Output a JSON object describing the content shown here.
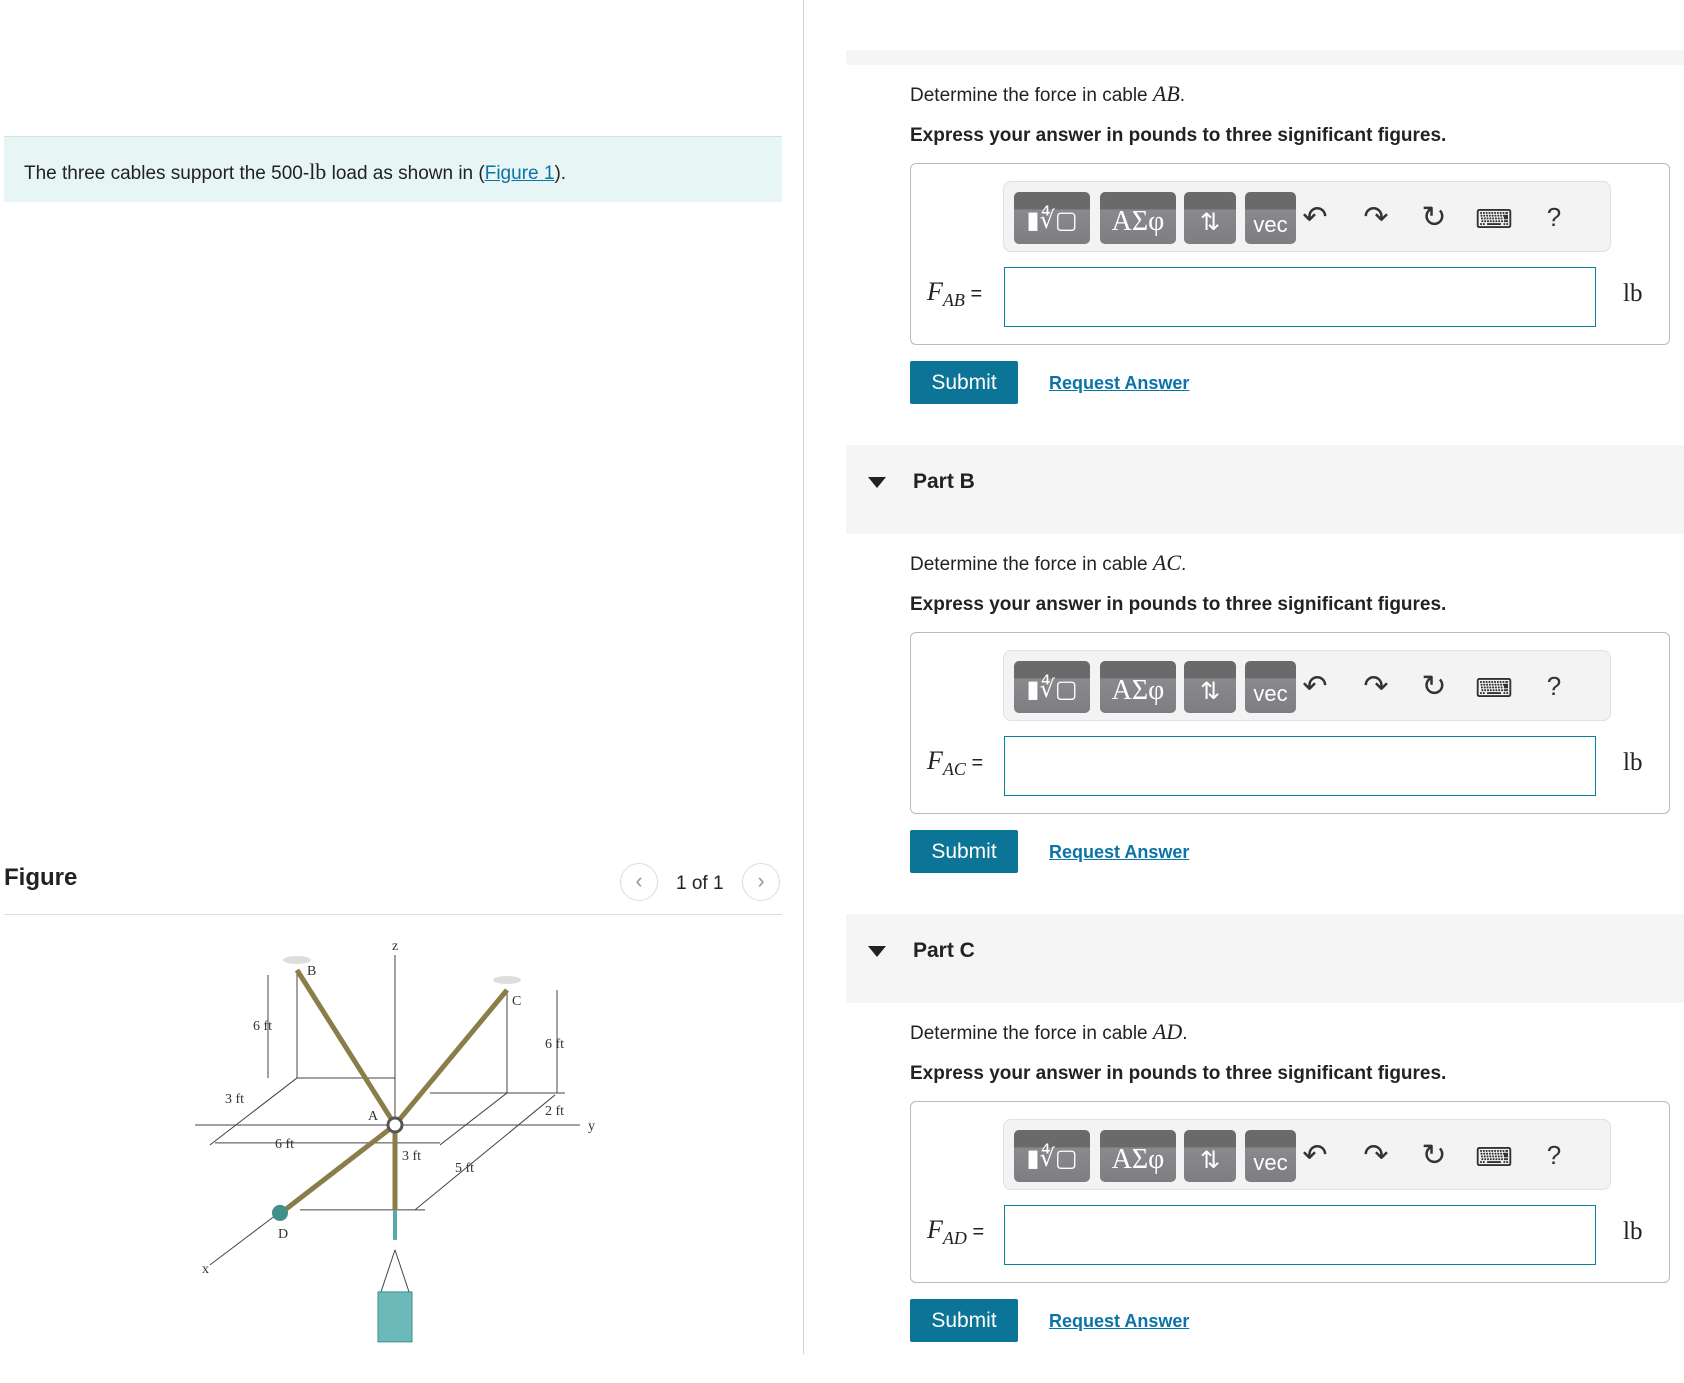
{
  "intro": {
    "text_before": "The three cables support the 500-",
    "unit": "lb",
    "text_mid": " load as shown in (",
    "link": "Figure 1",
    "text_after": ")."
  },
  "figure": {
    "title": "Figure",
    "pager": "1 of 1",
    "labels": {
      "z": "z",
      "y": "y",
      "x": "x",
      "A": "A",
      "B": "B",
      "C": "C",
      "D": "D",
      "d1": "6 ft",
      "d2": "3 ft",
      "d3": "6 ft",
      "d4": "6 ft",
      "d5": "2 ft",
      "d6": "3 ft",
      "d7": "5 ft"
    }
  },
  "toolbar": {
    "templates": "▮∜▢",
    "greek": "ΑΣφ",
    "arrows": "⇅",
    "vec": "vec",
    "help": "?"
  },
  "parts": [
    {
      "title": "",
      "question_prefix": "Determine the force in cable ",
      "cable": "AB",
      "question_suffix": ".",
      "instruction": "Express your answer in pounds to three significant figures.",
      "var": "F",
      "sub": "AB",
      "eq": " =",
      "value": "",
      "unit": "lb",
      "submit": "Submit",
      "request": "Request Answer"
    },
    {
      "title": "Part B",
      "question_prefix": "Determine the force in cable ",
      "cable": "AC",
      "question_suffix": ".",
      "instruction": "Express your answer in pounds to three significant figures.",
      "var": "F",
      "sub": "AC",
      "eq": " =",
      "value": "",
      "unit": "lb",
      "submit": "Submit",
      "request": "Request Answer"
    },
    {
      "title": "Part C",
      "question_prefix": "Determine the force in cable ",
      "cable": "AD",
      "question_suffix": ".",
      "instruction": "Express your answer in pounds to three significant figures.",
      "var": "F",
      "sub": "AD",
      "eq": " =",
      "value": "",
      "unit": "lb",
      "submit": "Submit",
      "request": "Request Answer"
    }
  ],
  "colors": {
    "accent": "#0b7497",
    "link": "#0b73a8",
    "intro_bg": "#e7f5f5"
  }
}
